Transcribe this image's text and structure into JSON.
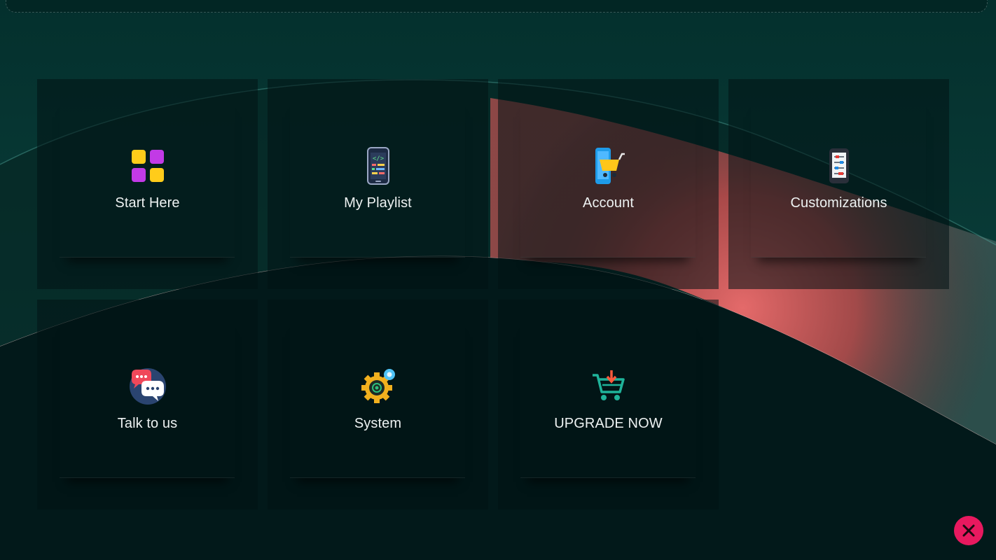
{
  "menu": {
    "tiles": [
      {
        "label": "Start Here",
        "icon": "app-grid-icon"
      },
      {
        "label": "My Playlist",
        "icon": "phone-code-icon"
      },
      {
        "label": "Account",
        "icon": "phone-cart-icon"
      },
      {
        "label": "Customizations",
        "icon": "settings-sliders-icon"
      },
      {
        "label": "Talk to us",
        "icon": "chat-bubbles-icon"
      },
      {
        "label": "System",
        "icon": "gear-icon"
      },
      {
        "label": "UPGRADE NOW",
        "icon": "cart-download-icon"
      }
    ]
  },
  "close_button": {
    "icon": "close-icon"
  },
  "colors": {
    "background": "#03302d",
    "accent_swoosh": "#e06666",
    "close_button": "#e8195f",
    "label_text": "#eef2f2"
  }
}
